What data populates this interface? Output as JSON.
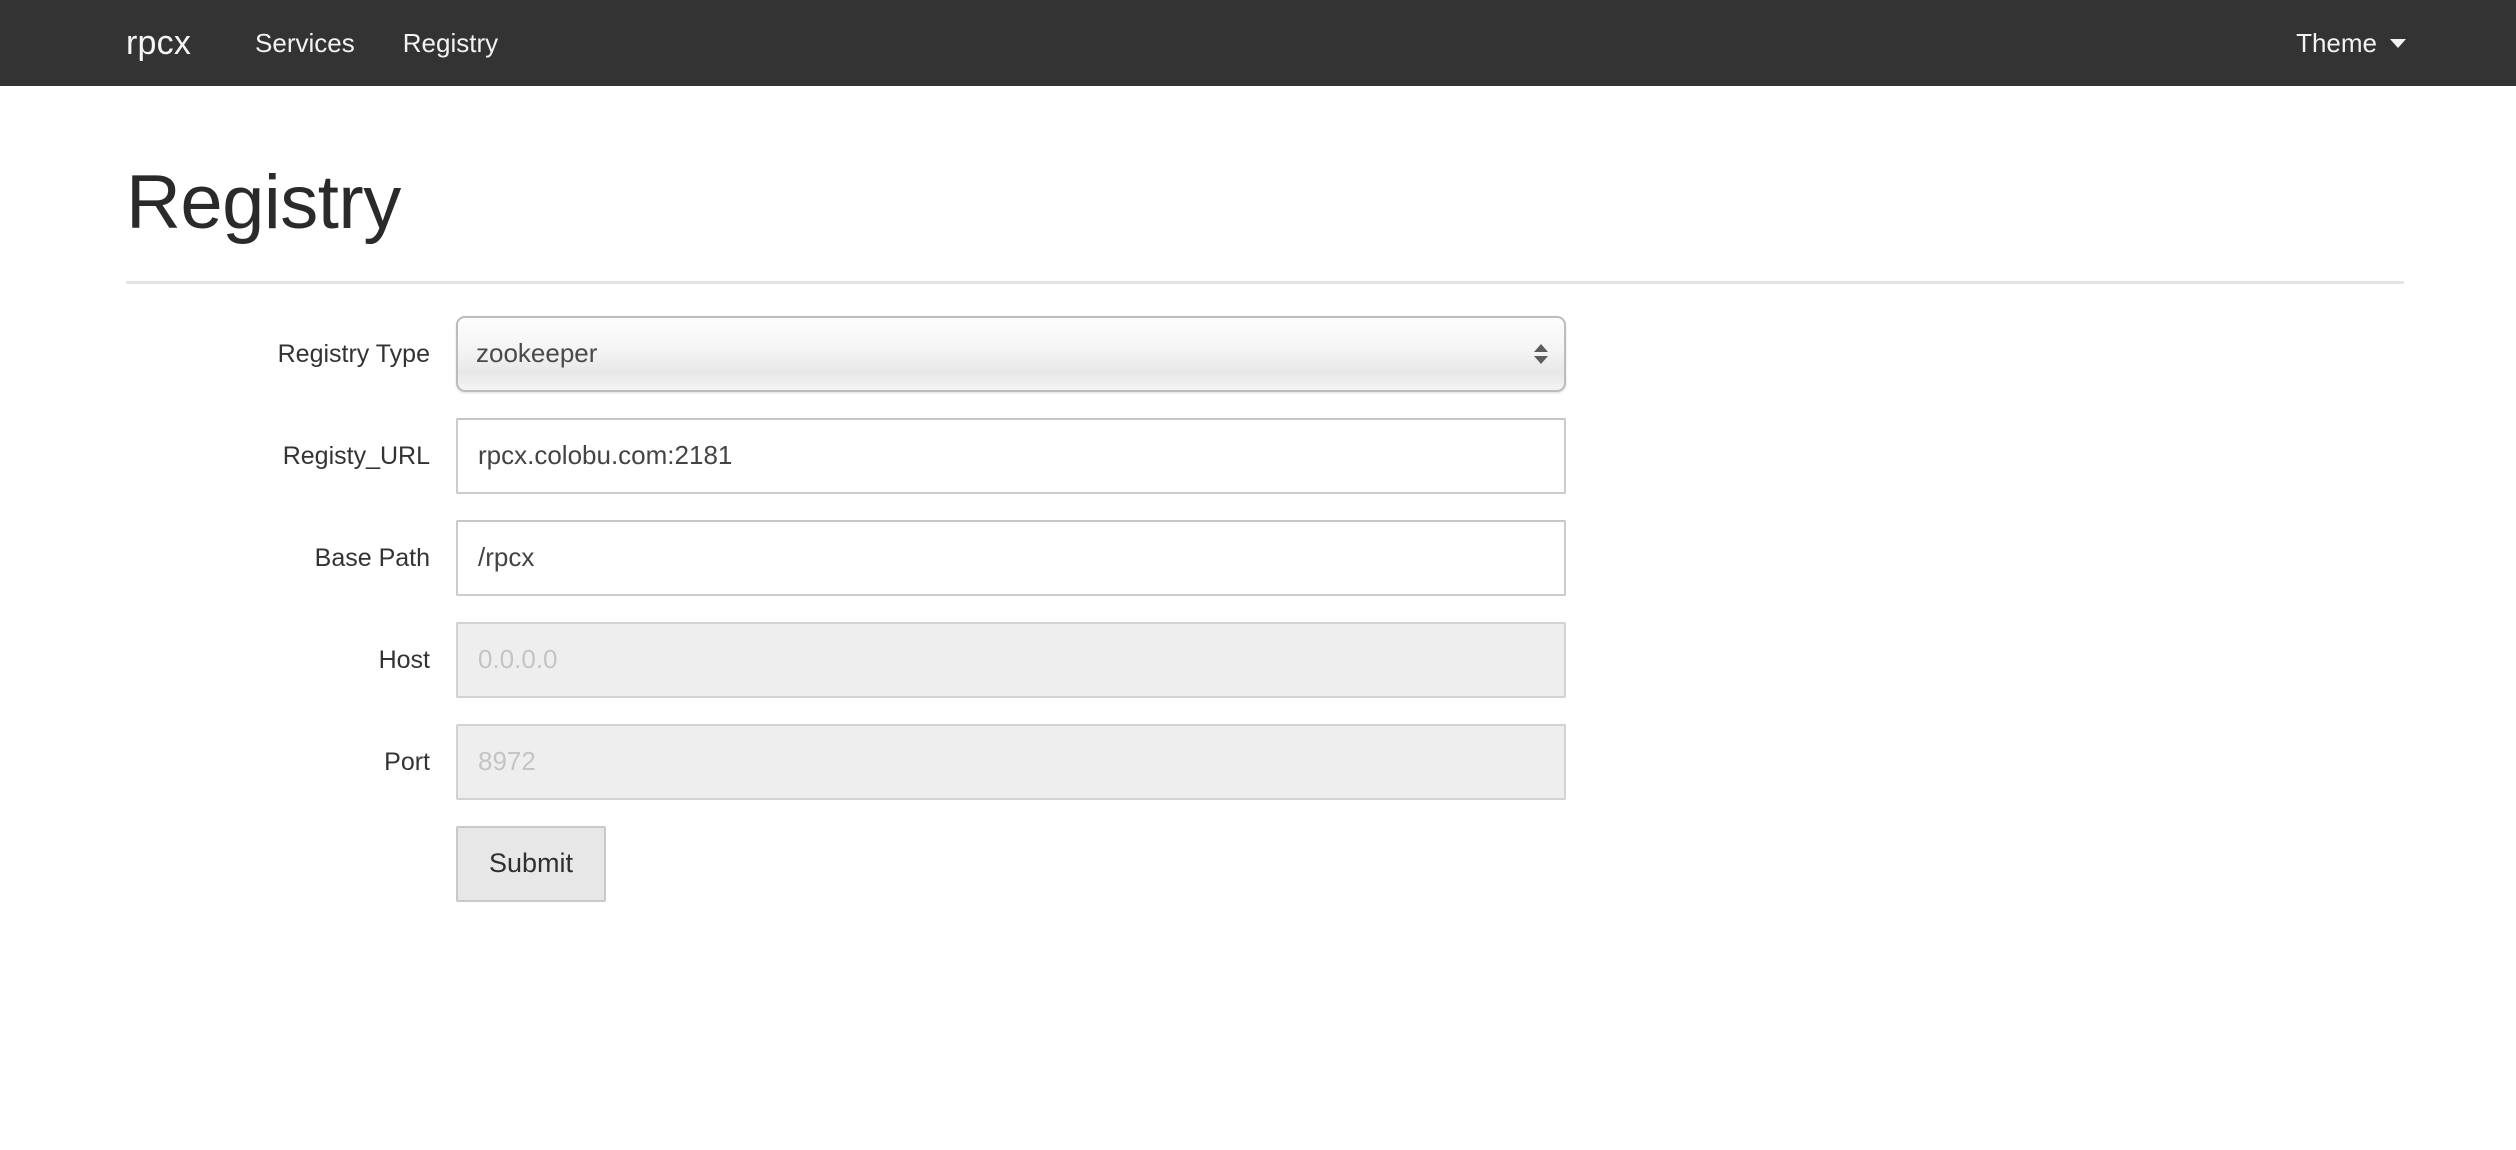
{
  "navbar": {
    "brand": "rpcx",
    "links": [
      {
        "label": "Services"
      },
      {
        "label": "Registry"
      }
    ],
    "theme": {
      "label": "Theme",
      "caret_icon": "caret-down-icon"
    },
    "background_color": "#333333",
    "text_color": "#f2f2f2"
  },
  "page": {
    "title": "Registry"
  },
  "form": {
    "rows": [
      {
        "label": "Registry Type",
        "type": "select",
        "value": "zookeeper",
        "options": [
          "zookeeper"
        ],
        "disabled": false,
        "stepper_icon": "updown-arrows-icon"
      },
      {
        "label": "Registy_URL",
        "type": "text",
        "value": "rpcx.colobu.com:2181",
        "placeholder": "",
        "disabled": false
      },
      {
        "label": "Base Path",
        "type": "text",
        "value": "/rpcx",
        "placeholder": "",
        "disabled": false
      },
      {
        "label": "Host",
        "type": "text",
        "value": "",
        "placeholder": "0.0.0.0",
        "disabled": true
      },
      {
        "label": "Port",
        "type": "text",
        "value": "",
        "placeholder": "8972",
        "disabled": true
      }
    ],
    "submit_label": "Submit"
  }
}
